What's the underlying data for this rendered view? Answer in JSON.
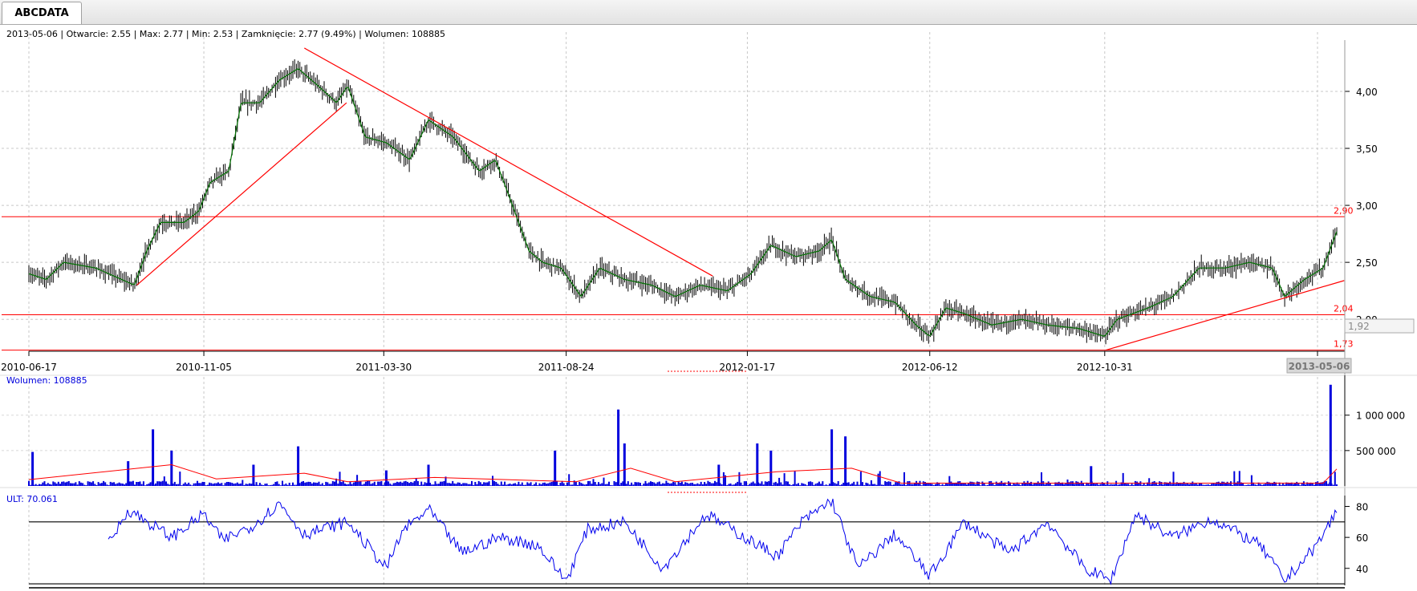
{
  "tab": {
    "label": "ABCDATA"
  },
  "info_bar": "2013-05-06 | Otwarcie: 2.55 | Max: 2.77 | Min: 2.53 | Zamknięcie: 2.77 (9.49%)  | Wolumen: 108885",
  "colors": {
    "candles": "#000000",
    "ma": "#007000",
    "lines": "#ff0000",
    "volume": "#0000dd",
    "ult": "#0000ee"
  },
  "chart_data": [
    {
      "type": "line",
      "panel": "price",
      "date_range": [
        "2010-06-17",
        "2013-05-06"
      ],
      "x_tick_labels": [
        "2010-06-17",
        "2010-11-05",
        "2011-03-30",
        "2011-08-24",
        "2012-01-17",
        "2012-06-12",
        "2012-10-31",
        "20"
      ],
      "cursor_date": "2013-05-06",
      "y_tick_labels": [
        "4,00",
        "3,50",
        "3,00",
        "2,50",
        "2,00"
      ],
      "ylim": [
        1.72,
        4.45
      ],
      "cursor_value": "1,92",
      "last_bar": {
        "date": "2013-05-06",
        "open": 2.55,
        "high": 2.77,
        "low": 2.53,
        "close": 2.77
      },
      "close_series": [
        [
          "2010-06-17",
          2.4
        ],
        [
          "2010-07-01",
          2.35
        ],
        [
          "2010-07-15",
          2.5
        ],
        [
          "2010-08-10",
          2.45
        ],
        [
          "2010-09-10",
          2.3
        ],
        [
          "2010-09-20",
          2.6
        ],
        [
          "2010-10-01",
          2.85
        ],
        [
          "2010-10-20",
          2.85
        ],
        [
          "2010-11-01",
          2.95
        ],
        [
          "2010-11-10",
          3.2
        ],
        [
          "2010-11-25",
          3.3
        ],
        [
          "2010-12-05",
          3.9
        ],
        [
          "2010-12-20",
          3.9
        ],
        [
          "2011-01-05",
          4.1
        ],
        [
          "2011-01-20",
          4.2
        ],
        [
          "2011-02-05",
          4.05
        ],
        [
          "2011-02-20",
          3.9
        ],
        [
          "2011-03-01",
          4.05
        ],
        [
          "2011-03-15",
          3.6
        ],
        [
          "2011-04-01",
          3.55
        ],
        [
          "2011-04-20",
          3.4
        ],
        [
          "2011-05-05",
          3.75
        ],
        [
          "2011-05-25",
          3.6
        ],
        [
          "2011-06-15",
          3.3
        ],
        [
          "2011-06-28",
          3.4
        ],
        [
          "2011-07-10",
          3.05
        ],
        [
          "2011-07-25",
          2.6
        ],
        [
          "2011-08-05",
          2.5
        ],
        [
          "2011-08-20",
          2.45
        ],
        [
          "2011-09-05",
          2.2
        ],
        [
          "2011-09-20",
          2.45
        ],
        [
          "2011-10-10",
          2.35
        ],
        [
          "2011-11-01",
          2.3
        ],
        [
          "2011-11-20",
          2.2
        ],
        [
          "2011-12-10",
          2.3
        ],
        [
          "2012-01-01",
          2.25
        ],
        [
          "2012-01-20",
          2.4
        ],
        [
          "2012-02-05",
          2.65
        ],
        [
          "2012-02-25",
          2.55
        ],
        [
          "2012-03-15",
          2.6
        ],
        [
          "2012-03-25",
          2.7
        ],
        [
          "2012-04-05",
          2.35
        ],
        [
          "2012-04-25",
          2.2
        ],
        [
          "2012-05-15",
          2.15
        ],
        [
          "2012-06-01",
          1.95
        ],
        [
          "2012-06-12",
          1.85
        ],
        [
          "2012-06-25",
          2.1
        ],
        [
          "2012-07-10",
          2.05
        ],
        [
          "2012-08-01",
          1.95
        ],
        [
          "2012-08-25",
          2.0
        ],
        [
          "2012-09-15",
          1.95
        ],
        [
          "2012-10-10",
          1.92
        ],
        [
          "2012-10-31",
          1.85
        ],
        [
          "2012-11-10",
          2.0
        ],
        [
          "2012-12-05",
          2.1
        ],
        [
          "2012-12-25",
          2.2
        ],
        [
          "2013-01-15",
          2.45
        ],
        [
          "2013-02-05",
          2.45
        ],
        [
          "2013-02-25",
          2.5
        ],
        [
          "2013-03-15",
          2.45
        ],
        [
          "2013-03-25",
          2.2
        ],
        [
          "2013-04-10",
          2.35
        ],
        [
          "2013-04-25",
          2.45
        ],
        [
          "2013-05-06",
          2.77
        ]
      ],
      "trend_lines": [
        {
          "from": [
            "2010-09-12",
            2.3
          ],
          "to": [
            "2011-02-28",
            3.9
          ]
        },
        {
          "from": [
            "2011-01-25",
            4.38
          ],
          "to": [
            "2011-12-20",
            2.38
          ]
        },
        {
          "from": [
            "2012-11-01",
            1.73
          ],
          "to": [
            "2013-05-12",
            2.34
          ]
        }
      ],
      "horizontal_levels": [
        {
          "value": 2.9,
          "label": "2,90"
        },
        {
          "value": 2.04,
          "label": "2,04"
        },
        {
          "value": 1.73,
          "label": "1,73"
        }
      ]
    },
    {
      "type": "bar",
      "panel": "volume",
      "title": "Wolumen: 108885",
      "y_tick_labels": [
        "1 000 000",
        "500 000"
      ],
      "ylim": [
        0,
        1450000
      ],
      "typical_volume": 40000,
      "spikes": [
        [
          "2010-06-20",
          480000
        ],
        [
          "2010-09-05",
          350000
        ],
        [
          "2010-09-25",
          800000
        ],
        [
          "2010-10-10",
          500000
        ],
        [
          "2010-12-15",
          300000
        ],
        [
          "2011-01-20",
          560000
        ],
        [
          "2011-04-01",
          220000
        ],
        [
          "2011-05-05",
          300000
        ],
        [
          "2011-08-15",
          500000
        ],
        [
          "2011-10-05",
          1080000
        ],
        [
          "2011-10-10",
          600000
        ],
        [
          "2011-12-25",
          300000
        ],
        [
          "2012-01-25",
          600000
        ],
        [
          "2012-02-05",
          500000
        ],
        [
          "2012-03-25",
          800000
        ],
        [
          "2012-04-05",
          700000
        ],
        [
          "2012-10-20",
          280000
        ],
        [
          "2013-05-01",
          1430000
        ]
      ],
      "moving_average": [
        [
          "2010-06-17",
          90000
        ],
        [
          "2010-10-10",
          300000
        ],
        [
          "2010-11-15",
          100000
        ],
        [
          "2011-01-25",
          180000
        ],
        [
          "2011-03-01",
          60000
        ],
        [
          "2011-05-10",
          120000
        ],
        [
          "2011-09-01",
          60000
        ],
        [
          "2011-10-15",
          250000
        ],
        [
          "2011-11-20",
          60000
        ],
        [
          "2012-02-10",
          200000
        ],
        [
          "2012-04-10",
          250000
        ],
        [
          "2012-05-20",
          40000
        ],
        [
          "2013-04-25",
          40000
        ],
        [
          "2013-05-06",
          240000
        ]
      ]
    },
    {
      "type": "line",
      "panel": "oscillator",
      "title": "ULT: 70.061",
      "y_tick_labels": [
        "80",
        "60",
        "40"
      ],
      "ylim": [
        29,
        87
      ],
      "reference_levels": [
        70,
        30
      ],
      "series": [
        [
          "2010-08-20",
          55
        ],
        [
          "2010-09-05",
          78
        ],
        [
          "2010-10-10",
          60
        ],
        [
          "2010-11-05",
          75
        ],
        [
          "2010-11-20",
          58
        ],
        [
          "2010-12-15",
          68
        ],
        [
          "2011-01-05",
          82
        ],
        [
          "2011-01-25",
          62
        ],
        [
          "2011-03-01",
          70
        ],
        [
          "2011-04-01",
          40
        ],
        [
          "2011-04-15",
          65
        ],
        [
          "2011-05-05",
          78
        ],
        [
          "2011-06-01",
          50
        ],
        [
          "2011-07-01",
          60
        ],
        [
          "2011-08-01",
          55
        ],
        [
          "2011-08-24",
          32
        ],
        [
          "2011-09-10",
          65
        ],
        [
          "2011-10-10",
          70
        ],
        [
          "2011-11-10",
          40
        ],
        [
          "2011-12-15",
          75
        ],
        [
          "2012-01-15",
          60
        ],
        [
          "2012-02-10",
          48
        ],
        [
          "2012-03-01",
          70
        ],
        [
          "2012-03-25",
          84
        ],
        [
          "2012-04-15",
          40
        ],
        [
          "2012-05-15",
          62
        ],
        [
          "2012-06-12",
          35
        ],
        [
          "2012-07-10",
          70
        ],
        [
          "2012-08-15",
          50
        ],
        [
          "2012-09-15",
          70
        ],
        [
          "2012-10-15",
          40
        ],
        [
          "2012-11-05",
          32
        ],
        [
          "2012-11-25",
          75
        ],
        [
          "2012-12-25",
          60
        ],
        [
          "2013-01-25",
          72
        ],
        [
          "2013-03-05",
          55
        ],
        [
          "2013-03-25",
          32
        ],
        [
          "2013-04-20",
          55
        ],
        [
          "2013-05-06",
          77
        ]
      ]
    }
  ]
}
